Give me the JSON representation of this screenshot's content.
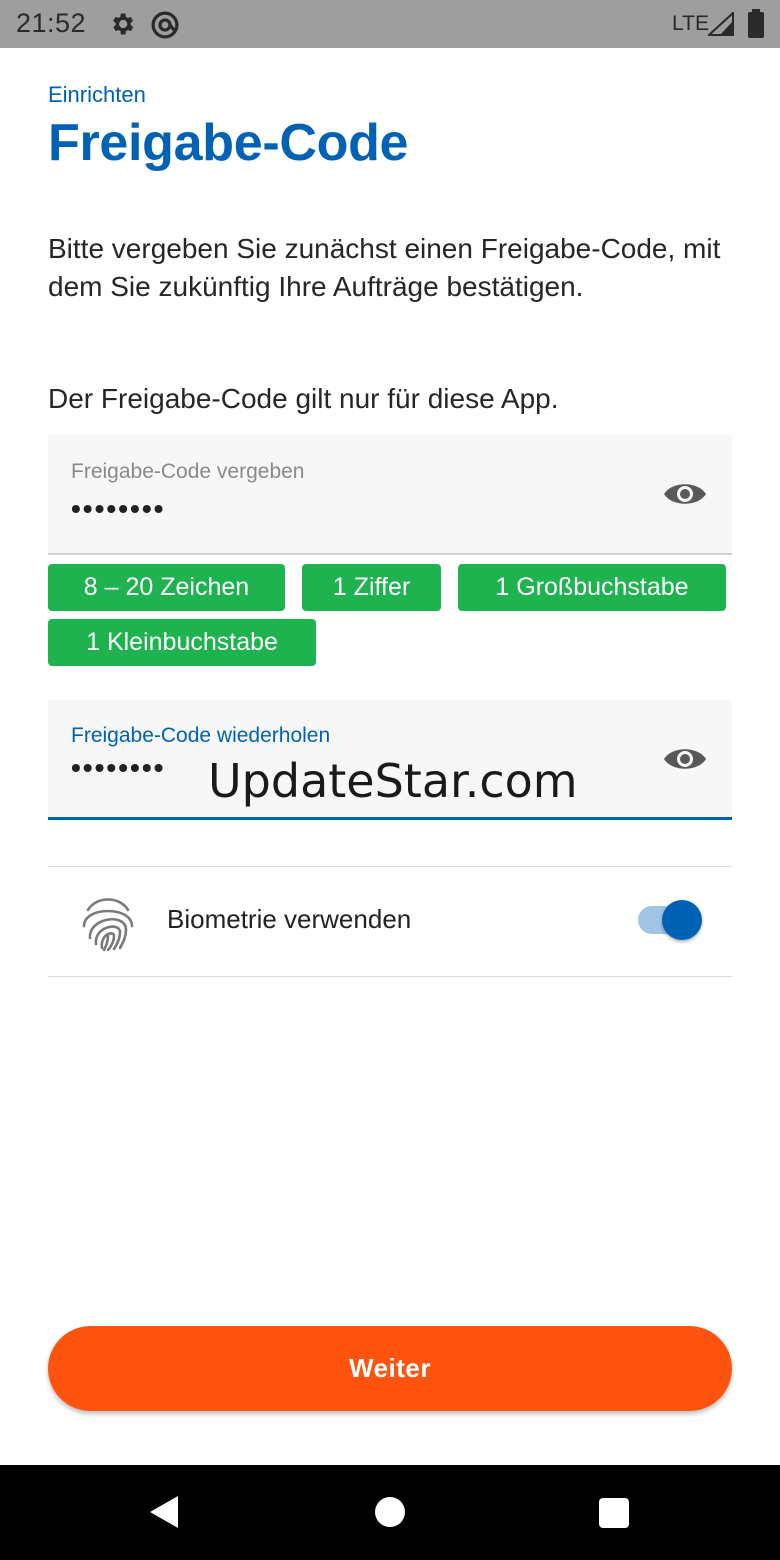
{
  "status_bar": {
    "time": "21:52",
    "network": "LTE"
  },
  "header": {
    "section": "Einrichten",
    "title": "Freigabe-Code"
  },
  "intro": {
    "paragraph_1": "Bitte vergeben Sie zunächst einen Freigabe-Code, mit dem Sie zukünftig Ihre Aufträge bestätigen.",
    "paragraph_2": "Der Freigabe-Code gilt nur für diese App."
  },
  "code_field": {
    "label": "Freigabe-Code vergeben",
    "value": "••••••••"
  },
  "requirements": [
    "8 – 20 Zeichen",
    "1 Ziffer",
    "1 Großbuchstabe",
    "1 Kleinbuchstabe"
  ],
  "repeat_field": {
    "label": "Freigabe-Code wiederholen",
    "value": "••••••••"
  },
  "watermark": "UpdateStar.com",
  "biometrics": {
    "label": "Biometrie verwenden",
    "enabled": true
  },
  "primary_button": {
    "label": "Weiter"
  },
  "colors": {
    "brand_blue": "#0062b4",
    "chip_green": "#1fb350",
    "button_orange": "#ff540f"
  },
  "icons": [
    "settings-icon",
    "at-icon",
    "signal-icon",
    "battery-icon",
    "eye-icon",
    "fingerprint-icon",
    "back-icon",
    "home-icon",
    "recent-apps-icon"
  ]
}
